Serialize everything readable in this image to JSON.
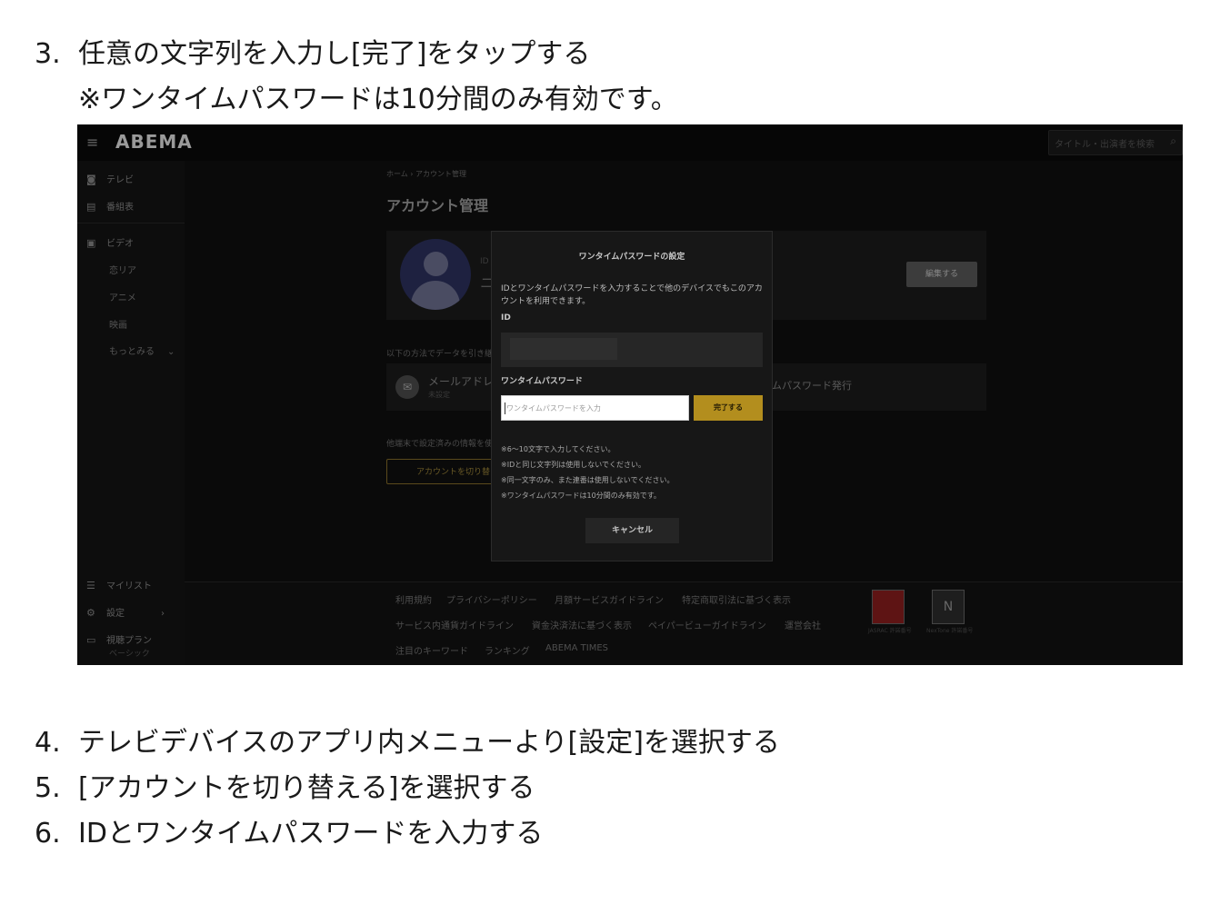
{
  "steps": [
    {
      "num": "3.",
      "text": "任意の文字列を入力し[完了]をタップする"
    },
    {
      "num": "4.",
      "text": "テレビデバイスのアプリ内メニューより[設定]を選択する"
    },
    {
      "num": "5.",
      "text": "[アカウントを切り替える]を選択する"
    },
    {
      "num": "6.",
      "text": "IDとワンタイムパスワードを入力する"
    }
  ],
  "note": "※ワンタイムパスワードは10分間のみ有効です。",
  "app": {
    "logo": "ABEMA",
    "search_placeholder": "タイトル・出演者を検索",
    "sidebar": {
      "tv": "テレビ",
      "schedule": "番組表",
      "video": "ビデオ",
      "sub_items": [
        "恋リア",
        "アニメ",
        "映画"
      ],
      "more": "もっとみる",
      "mylist": "マイリスト",
      "settings": "設定",
      "plan": "視聴プラン",
      "plan_sub": "ベーシック"
    },
    "breadcrumb": "ホーム › アカウント管理",
    "page_title": "アカウント管理",
    "card_id_label": "ID",
    "card_name": "ニ",
    "edit_button": "編集する",
    "restore_text": "以下の方法でデータを引き継",
    "mail_label": "メールアドレス",
    "mail_sub": "未設定",
    "otp_issue": "ムパスワード発行",
    "other_device_text": "他端末で設定済みの情報を使",
    "switch_button": "アカウントを切り替",
    "footer": {
      "row1": [
        "利用規約",
        "プライバシーポリシー",
        "月額サービスガイドライン",
        "特定商取引法に基づく表示"
      ],
      "row2": [
        "サービス内通貨ガイドライン",
        "資金決済法に基づく表示",
        "ペイパービューガイドライン",
        "運営会社"
      ],
      "row3": [
        "注目のキーワード",
        "ランキング",
        "ABEMA TIMES"
      ],
      "jasrac_caption": "JASRAC 許諾番号",
      "nextone_caption": "NexTone 許諾番号"
    }
  },
  "modal": {
    "title": "ワンタイムパスワードの設定",
    "description": "IDとワンタイムパスワードを入力することで他のデバイスでもこのアカウントを利用できます。",
    "id_label": "ID",
    "otp_label": "ワンタイムパスワード",
    "otp_placeholder": "ワンタイムパスワードを入力",
    "done_button": "完了する",
    "notes": [
      "※6〜10文字で入力してください。",
      "※IDと同じ文字列は使用しないでください。",
      "※同一文字のみ、また連番は使用しないでください。",
      "※ワンタイムパスワードは10分間のみ有効です。"
    ],
    "cancel_button": "キャンセル"
  },
  "colors": {
    "accent": "#b38e1e",
    "background_dark": "#0a0a0a",
    "avatar": "#1e2140"
  }
}
